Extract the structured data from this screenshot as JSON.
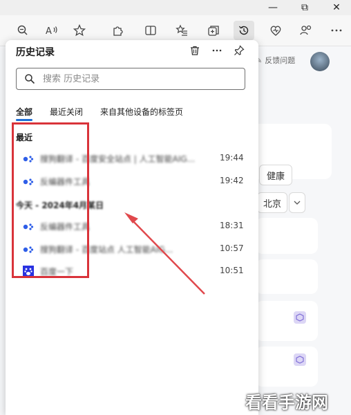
{
  "window": {
    "minimize": "—",
    "restore": "⧉",
    "close": "✕"
  },
  "toolbar": {
    "icons": [
      "zoom-out-icon",
      "read-aloud-icon",
      "favorite-star-icon",
      "extensions-icon",
      "split-screen-icon",
      "favorites-list-icon",
      "collections-icon",
      "history-icon",
      "browser-essentials-icon",
      "profile-icon",
      "more-icon"
    ],
    "active": "history-icon"
  },
  "behind": {
    "feedback_label": "反馈问题",
    "chip_health": "健康",
    "chip_city": "北京"
  },
  "history_panel": {
    "title": "历史记录",
    "search_placeholder": "搜索 历史记录",
    "tabs": [
      "全部",
      "最近关闭",
      "来自其他设备的标签页"
    ],
    "active_tab": "全部",
    "section_recent": "最近",
    "section_date": "今天 - 2024年4月某日",
    "items": [
      {
        "title": "搜狗翻译 - 百度安全站点 | 人工智能AIG...",
        "time": "19:44",
        "icon": "baidu-icon"
      },
      {
        "title": "反编器件工具",
        "time": "19:42",
        "icon": "baidu-icon"
      },
      {
        "title": "反编器件工具",
        "time": "18:31",
        "icon": "baidu-icon"
      },
      {
        "title": "搜狗翻译 - 百度站点 人工智能AIG...",
        "time": "10:57",
        "icon": "baidu-icon"
      },
      {
        "title": "百度一下",
        "time": "10:51",
        "icon": "baidu-paw-icon"
      }
    ]
  },
  "watermark": "看看手游网",
  "colors": {
    "accent": "#1d6fd6",
    "annotation": "#d9333a"
  }
}
